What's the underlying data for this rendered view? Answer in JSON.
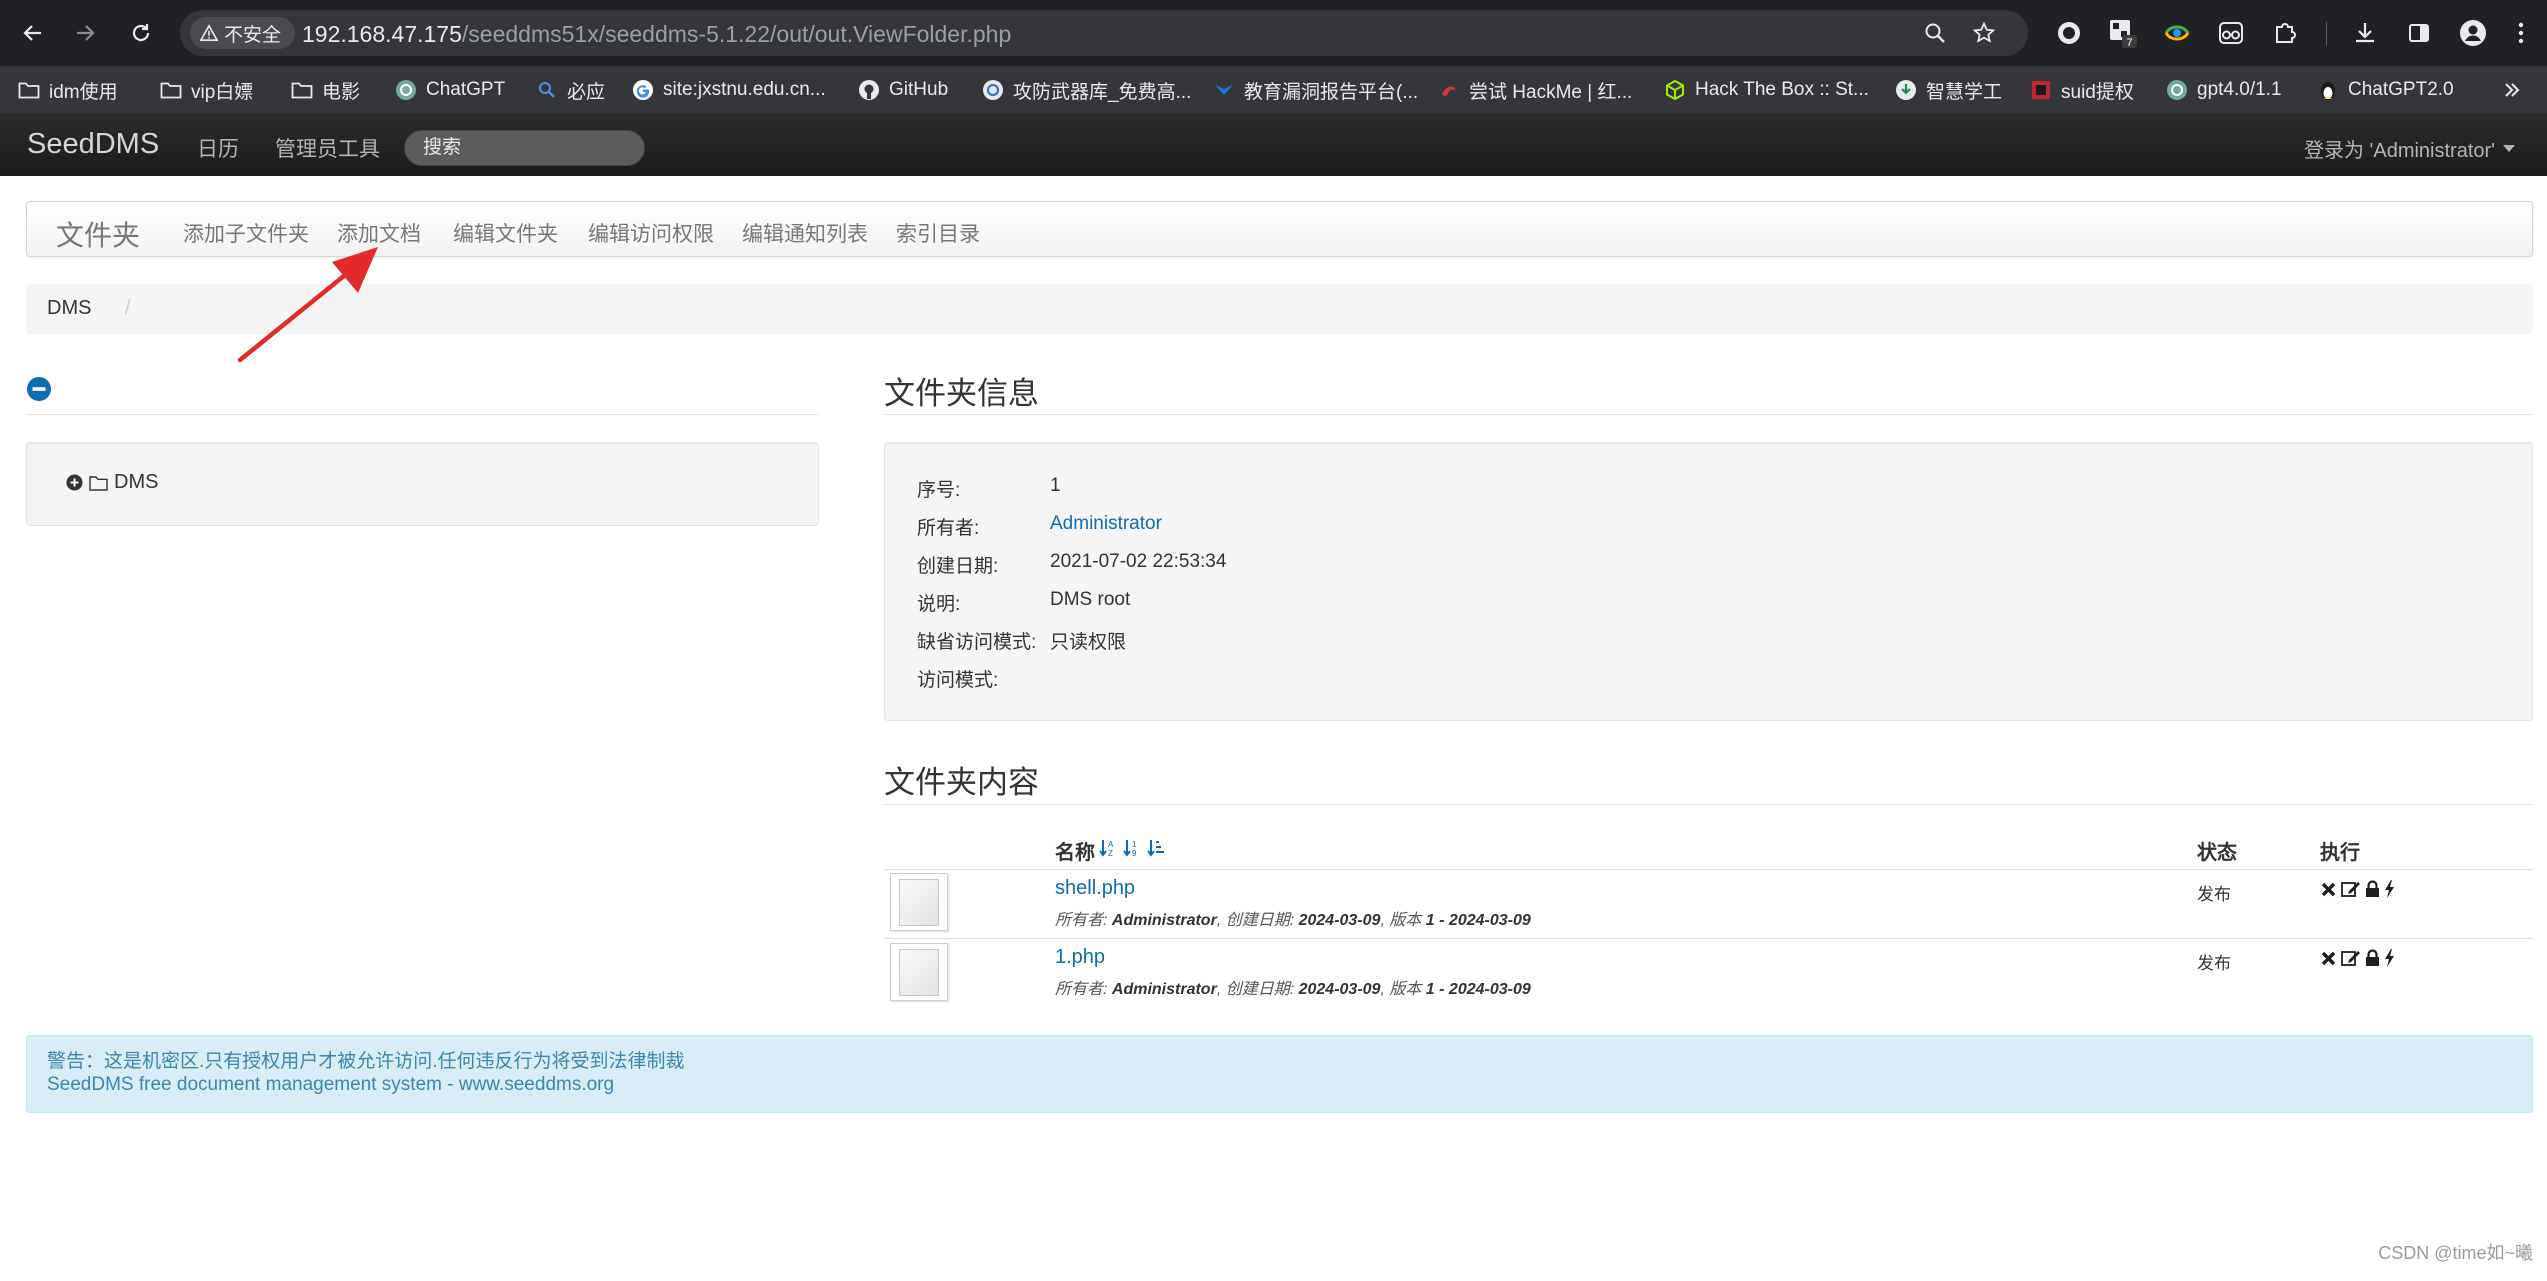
{
  "browser": {
    "security_label": "不安全",
    "url_host": "192.168.47.175",
    "url_path": "/seeddms51x/seeddms-5.1.22/out/out.ViewFolder.php",
    "extension_badge": "7",
    "bookmarks": [
      {
        "label": "idm使用",
        "icon": "folder-icon"
      },
      {
        "label": "vip白嫖",
        "icon": "folder-icon"
      },
      {
        "label": "电影",
        "icon": "folder-icon"
      },
      {
        "label": "ChatGPT",
        "icon": "openai-icon"
      },
      {
        "label": "必应",
        "icon": "bing-search-icon"
      },
      {
        "label": "site:jxstnu.edu.cn...",
        "icon": "google-icon"
      },
      {
        "label": "GitHub",
        "icon": "github-icon"
      },
      {
        "label": "攻防武器库_免费高...",
        "icon": "weapon-library-icon"
      },
      {
        "label": "教育漏洞报告平台(...",
        "icon": "edu-vuln-icon"
      },
      {
        "label": "尝试 HackMe | 红...",
        "icon": "hackme-icon"
      },
      {
        "label": "Hack The Box :: St...",
        "icon": "htb-cube-icon"
      },
      {
        "label": "智慧学工",
        "icon": "smart-campus-icon"
      },
      {
        "label": "suid提权",
        "icon": "suid-icon"
      },
      {
        "label": "gpt4.0/1.1",
        "icon": "openai-icon"
      },
      {
        "label": "ChatGPT2.0",
        "icon": "linux-tux-icon"
      }
    ]
  },
  "navbar": {
    "brand": "SeedDMS",
    "calendar": "日历",
    "admin_tools": "管理员工具",
    "search_placeholder": "搜索",
    "user_menu": "登录为 'Administrator'"
  },
  "folder_bar": {
    "title": "文件夹",
    "items": [
      "添加子文件夹",
      "添加文档",
      "编辑文件夹",
      "编辑访问权限",
      "编辑通知列表",
      "索引目录"
    ]
  },
  "breadcrumb": {
    "root": "DMS",
    "separator": "/"
  },
  "tree": {
    "root": "DMS"
  },
  "folder_info": {
    "title": "文件夹信息",
    "rows": [
      {
        "label": "序号:",
        "value": "1"
      },
      {
        "label": "所有者:",
        "value": "Administrator"
      },
      {
        "label": "创建日期:",
        "value": "2021-07-02 22:53:34"
      },
      {
        "label": "说明:",
        "value": "DMS root"
      },
      {
        "label": "缺省访问模式:",
        "value": "只读权限"
      },
      {
        "label": "访问模式:",
        "value": ""
      }
    ]
  },
  "folder_content": {
    "title": "文件夹内容",
    "headers": {
      "name": "名称",
      "status": "状态",
      "actions": "执行"
    },
    "documents": [
      {
        "name": "shell.php",
        "owner_label": "所有者: ",
        "owner": "Administrator",
        "created_label": ", 创建日期: ",
        "created": "2024-03-09",
        "version_label": ", 版本 ",
        "version": "1 - 2024-03-09",
        "status": "发布"
      },
      {
        "name": "1.php",
        "owner_label": "所有者: ",
        "owner": "Administrator",
        "created_label": ", 创建日期: ",
        "created": "2024-03-09",
        "version_label": ", 版本 ",
        "version": "1 - 2024-03-09",
        "status": "发布"
      }
    ]
  },
  "footer": {
    "warning": "警告：这是机密区.只有授权用户才被允许访问.任何违反行为将受到法律制裁",
    "line2": "SeedDMS free document management system - www.seeddms.org"
  },
  "watermark": "CSDN @time如~曦",
  "colors": {
    "link": "#0e6cb3",
    "annotation_arrow": "#e32b2b",
    "alert_text": "#3a87ad"
  }
}
